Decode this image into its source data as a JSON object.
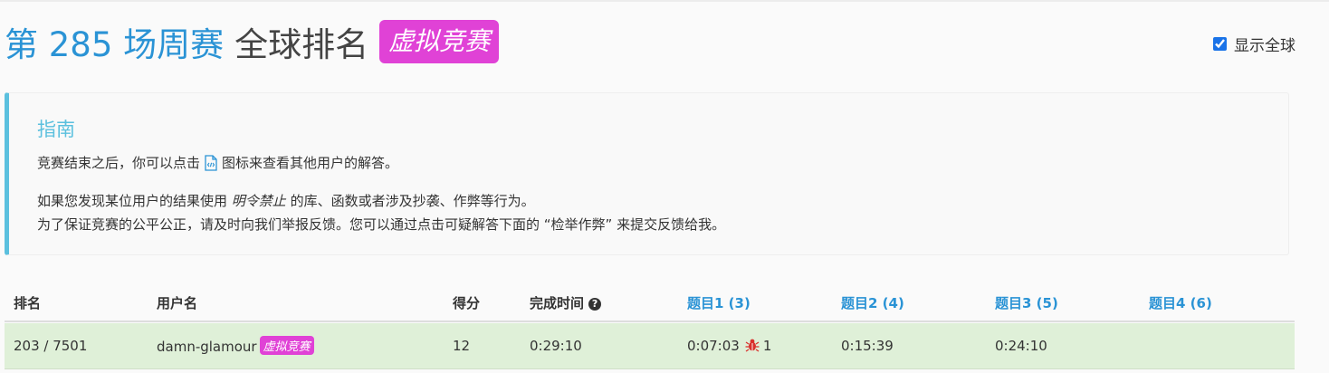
{
  "header": {
    "contest_title": "第 285 场周赛",
    "rest_title": "全球排名",
    "virtual_badge": "虚拟竞赛",
    "show_global_label": "显示全球",
    "show_global_checked": true
  },
  "guide": {
    "title": "指南",
    "line1_before": "竞赛结束之后，你可以点击",
    "line1_after": "图标来查看其他用户的解答。",
    "line2_before": "如果您发现某位用户的结果使用 ",
    "line2_em": "明令禁止",
    "line2_after": " 的库、函数或者涉及抄袭、作弊等行为。",
    "line3": "为了保证竞赛的公平公正，请及时向我们举报反馈。您可以通过点击可疑解答下面的 “检举作弊” 来提交反馈给我。",
    "icon": "code-file-icon"
  },
  "table": {
    "headers": {
      "rank": "排名",
      "username": "用户名",
      "score": "得分",
      "finish_time": "完成时间",
      "q1": "题目1 (3)",
      "q2": "题目2 (4)",
      "q3": "题目3 (5)",
      "q4": "题目4 (6)"
    },
    "row": {
      "rank": "203 / 7501",
      "username": "damn-glamour",
      "badge": "虚拟竞赛",
      "score": "12",
      "finish_time": "0:29:10",
      "q1_time": "0:07:03",
      "q1_wrong": "1",
      "q2_time": "0:15:39",
      "q3_time": "0:24:10",
      "q4_time": ""
    }
  },
  "colors": {
    "accent": "#2a93d5",
    "badge": "#e042d6",
    "guide_border": "#5bc0de",
    "row_success": "#dff0d8",
    "bug": "#d9302c"
  }
}
